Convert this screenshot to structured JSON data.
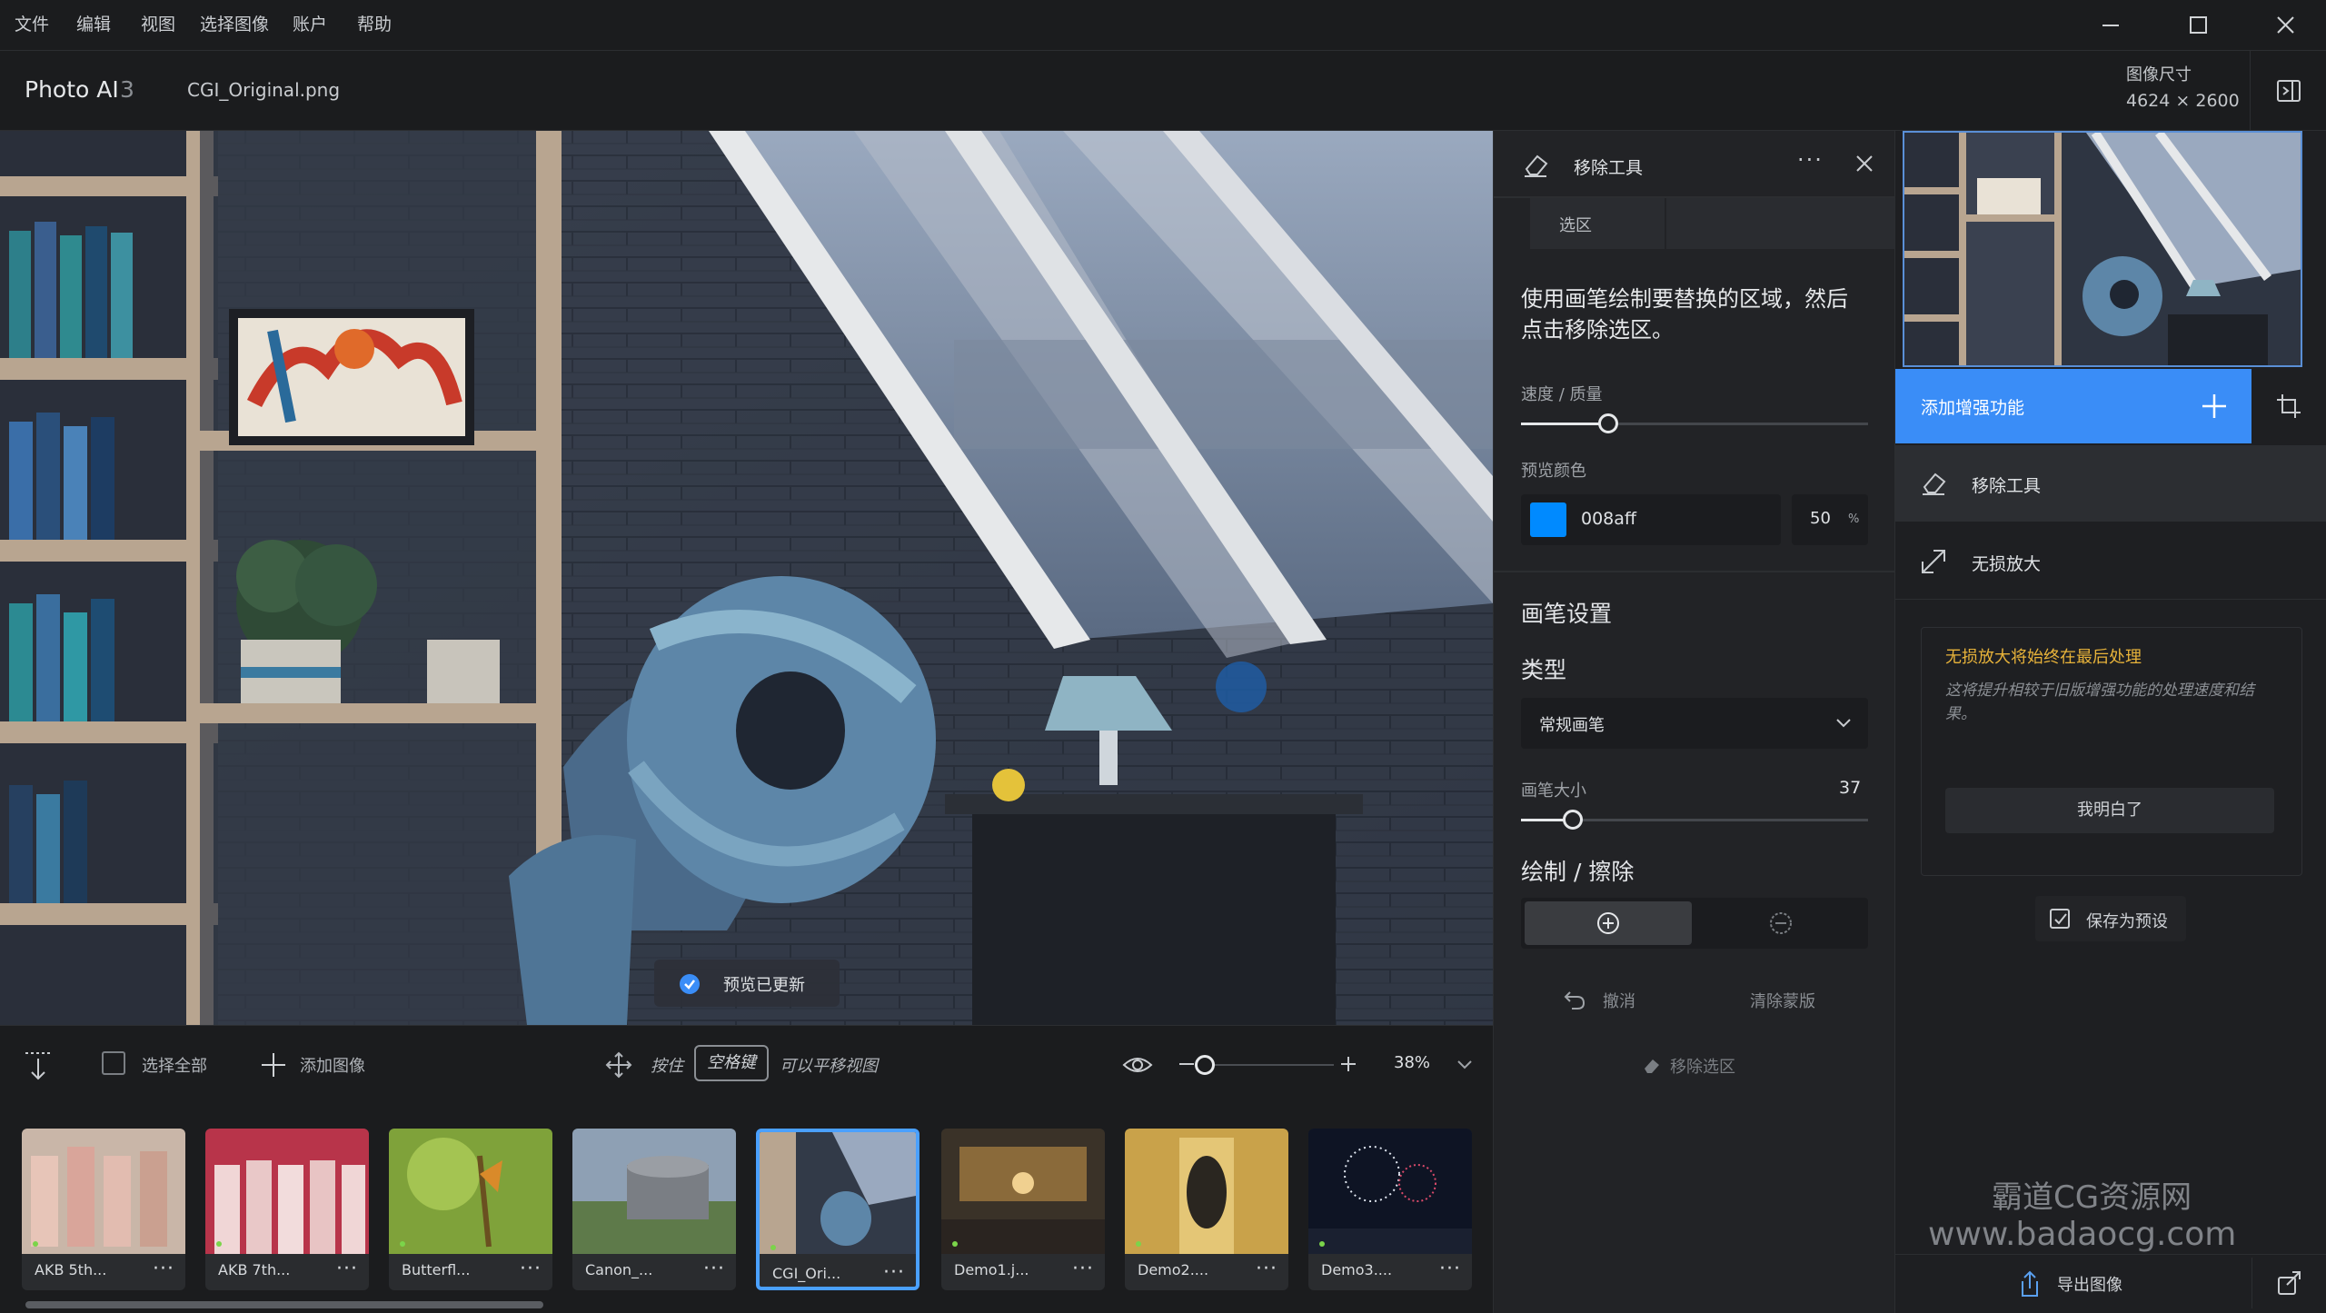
{
  "menu": [
    "文件",
    "编辑",
    "视图",
    "选择图像",
    "账户",
    "帮助"
  ],
  "app": {
    "name": "Photo AI",
    "version": "3",
    "file": "CGI_Original.png"
  },
  "image_size": {
    "label": "图像尺寸",
    "value": "4624 × 2600"
  },
  "canvas": {
    "toast": "预览已更新"
  },
  "toolbar": {
    "select_all": "选择全部",
    "add_image": "添加图像",
    "hint_press": "按住",
    "hint_key": "空格键",
    "hint_rest": "可以平移视图",
    "zoom": "38%",
    "zoom_fraction": 0.05
  },
  "thumbnails": [
    {
      "name": "AKB 5th...",
      "selected": false
    },
    {
      "name": "AKB 7th...",
      "selected": false
    },
    {
      "name": "Butterfl...",
      "selected": false
    },
    {
      "name": "Canon_...",
      "selected": false
    },
    {
      "name": "CGI_Ori...",
      "selected": true
    },
    {
      "name": "Demo1.j...",
      "selected": false
    },
    {
      "name": "Demo2....",
      "selected": false
    },
    {
      "name": "Demo3....",
      "selected": false
    }
  ],
  "tool_panel": {
    "title": "移除工具",
    "tab": "选区",
    "instructions": "使用画笔绘制要替换的区域，然后点击移除选区。",
    "speed_quality_label": "速度 / 质量",
    "speed_quality_fraction": 0.25,
    "preview_color_label": "预览颜色",
    "preview_color_hex": "008aff",
    "preview_color_swatch": "#008aff",
    "preview_opacity": "50",
    "preview_opacity_unit": "%",
    "brush_settings": "画笔设置",
    "type_label": "类型",
    "type_value": "常规画笔",
    "brush_size_label": "画笔大小",
    "brush_size": "37",
    "brush_size_fraction": 0.15,
    "draw_erase": "绘制 / 擦除",
    "undo": "撤消",
    "clear_mask": "清除蒙版",
    "remove_selection": "移除选区"
  },
  "right_panel": {
    "add_enhancement": "添加增强功能",
    "items": [
      {
        "label": "移除工具",
        "active": true
      },
      {
        "label": "无损放大",
        "active": false
      }
    ],
    "notice_title": "无损放大将始终在最后处理",
    "notice_body": "这将提升相较于旧版增强功能的处理速度和结果。",
    "notice_button": "我明白了",
    "save_preset": "保存为预设",
    "export": "导出图像",
    "watermark_line1": "霸道CG资源网",
    "watermark_line2": "www.badaocg.com"
  },
  "colors": {
    "accent": "#3a8df7",
    "notice_title": "#e8b33a"
  }
}
